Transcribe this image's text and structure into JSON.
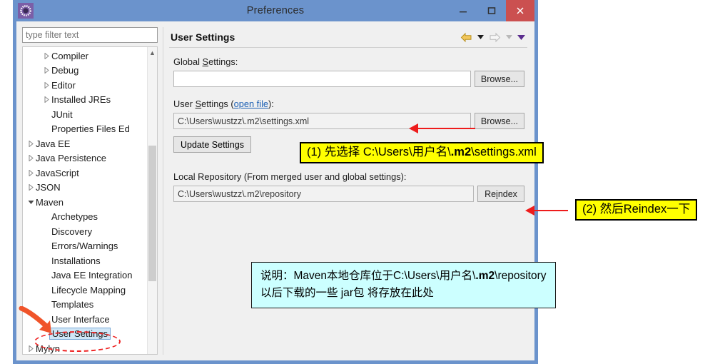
{
  "window": {
    "title": "Preferences",
    "icon": "gear-icon",
    "minimize_label": "–",
    "maximize_label": "⬜",
    "close_label": "✕",
    "titlebar_color": "#6b93cc",
    "close_color": "#cb5050"
  },
  "sidebar": {
    "filter_placeholder": "type filter text",
    "filter_value": "",
    "selected": "User Settings",
    "items": [
      {
        "label": "Compiler",
        "level": 2,
        "arrow": "collapsed"
      },
      {
        "label": "Debug",
        "level": 2,
        "arrow": "collapsed"
      },
      {
        "label": "Editor",
        "level": 2,
        "arrow": "collapsed"
      },
      {
        "label": "Installed JREs",
        "level": 2,
        "arrow": "collapsed"
      },
      {
        "label": "JUnit",
        "level": 2,
        "arrow": "none"
      },
      {
        "label": "Properties Files Ed",
        "level": 2,
        "arrow": "none"
      },
      {
        "label": "Java EE",
        "level": 1,
        "arrow": "collapsed"
      },
      {
        "label": "Java Persistence",
        "level": 1,
        "arrow": "collapsed"
      },
      {
        "label": "JavaScript",
        "level": 1,
        "arrow": "collapsed"
      },
      {
        "label": "JSON",
        "level": 1,
        "arrow": "collapsed"
      },
      {
        "label": "Maven",
        "level": 1,
        "arrow": "expanded"
      },
      {
        "label": "Archetypes",
        "level": 2,
        "arrow": "none"
      },
      {
        "label": "Discovery",
        "level": 2,
        "arrow": "none"
      },
      {
        "label": "Errors/Warnings",
        "level": 2,
        "arrow": "none"
      },
      {
        "label": "Installations",
        "level": 2,
        "arrow": "none"
      },
      {
        "label": "Java EE Integration",
        "level": 2,
        "arrow": "none"
      },
      {
        "label": "Lifecycle Mapping",
        "level": 2,
        "arrow": "none"
      },
      {
        "label": "Templates",
        "level": 2,
        "arrow": "none"
      },
      {
        "label": "User Interface",
        "level": 2,
        "arrow": "none"
      },
      {
        "label": "User Settings",
        "level": 2,
        "arrow": "none",
        "selected": true
      },
      {
        "label": "Mylyn",
        "level": 1,
        "arrow": "collapsed"
      }
    ]
  },
  "page": {
    "title": "User Settings",
    "nav": {
      "back_icon": "back-arrow-icon",
      "back_menu_icon": "chevron-down-icon",
      "forward_icon": "forward-arrow-icon",
      "forward_menu_icon": "chevron-down-icon",
      "view_menu_icon": "chevron-down-icon"
    },
    "global_settings": {
      "label_pre": "Global ",
      "label_key": "S",
      "label_post": "ettings:",
      "value": "",
      "browse_label": "Browse..."
    },
    "user_settings": {
      "label_pre": "User ",
      "label_key": "S",
      "label_mid": "ettings (",
      "link": "open file",
      "label_post": "):",
      "value": "C:\\Users\\wustzz\\.m2\\settings.xml",
      "browse_label": "Browse..."
    },
    "update_button": "Update Settings",
    "local_repository": {
      "label": "Local Repository (From merged user and global settings):",
      "value": "C:\\Users\\wustzz\\.m2\\repository",
      "reindex_pre": "Re",
      "reindex_key": "i",
      "reindex_post": "ndex"
    }
  },
  "annotations": {
    "step1": {
      "text_pre": "(1) 先选择 C:\\Users\\用户名\\",
      "text_bold": ".m2",
      "text_post": "\\settings.xml",
      "bg": "#ffff00"
    },
    "step2": {
      "text": "(2) 然后Reindex一下",
      "bg": "#ffff00"
    },
    "note": {
      "line1_pre": "说明：Maven本地仓库位于C:\\Users\\用户名\\",
      "line1_bold": ".m2",
      "line1_post": "\\repository",
      "line2": "以后下载的一些 jar包 将存放在此处",
      "bg": "#ccffff"
    },
    "arrow_color": "#ee1c1c"
  }
}
